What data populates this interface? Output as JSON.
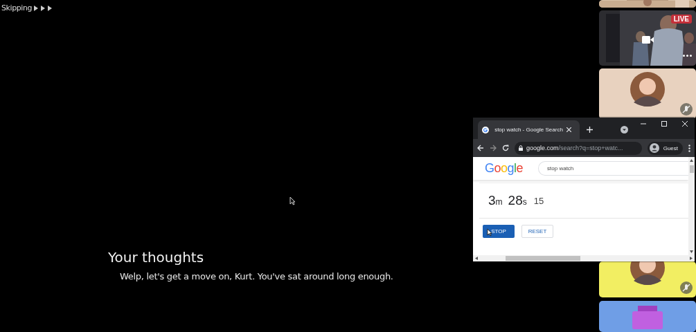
{
  "game": {
    "skip_indicator": "Skipping",
    "speaker": "Your thoughts",
    "line": "Welp, let's get a move on, Kurt. You've sat around long enough."
  },
  "browser": {
    "tab_title": "stop watch - Google Search",
    "url_host": "google.com",
    "url_path": "/search?q=stop+watc...",
    "profile": "Guest",
    "logo": "Google",
    "search_value": "stop watch",
    "stopwatch": {
      "minutes": "3",
      "minutes_unit": "m",
      "seconds": "28",
      "seconds_unit": "s",
      "hundredths": "15"
    },
    "buttons": [
      {
        "label": "STOP",
        "kind": "primary"
      },
      {
        "label": "RESET",
        "kind": "secondary"
      }
    ]
  },
  "tiles": [
    {
      "kind": "picture",
      "color": "#d8c2a8"
    },
    {
      "kind": "live",
      "color": "#2c2c30",
      "badge": "LIVE"
    },
    {
      "kind": "avatar",
      "color": "#e8d2bf",
      "muted": true
    },
    {
      "kind": "avatar",
      "color": "#f2ee62",
      "muted": true
    },
    {
      "kind": "boombox",
      "color": "#6f9ee6"
    }
  ]
}
